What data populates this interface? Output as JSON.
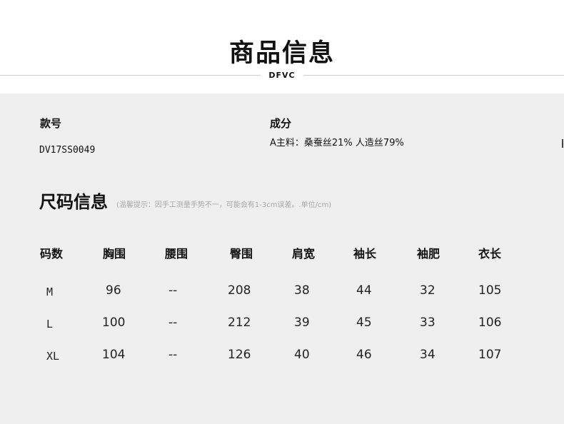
{
  "header": {
    "title": "商品信息",
    "brand": "DFVC"
  },
  "info": {
    "style_label": "款号",
    "style_value": "DV17SS0049",
    "composition_label": "成分",
    "composition_value": "A主料：桑蚕丝21% 人造丝79%"
  },
  "size": {
    "title": "尺码信息",
    "note": "(温馨提示：因手工测量手势不一，可能会有1-3cm误差。.单位/cm)"
  },
  "table": {
    "headers": [
      "码数",
      "胸围",
      "腰围",
      "臀围",
      "肩宽",
      "袖长",
      "袖肥",
      "衣长"
    ],
    "rows": [
      [
        "M",
        "96",
        "--",
        "208",
        "38",
        "44",
        "32",
        "105"
      ],
      [
        "L",
        "100",
        "--",
        "212",
        "39",
        "45",
        "33",
        "106"
      ],
      [
        "XL",
        "104",
        "--",
        "126",
        "40",
        "46",
        "34",
        "107"
      ]
    ]
  }
}
